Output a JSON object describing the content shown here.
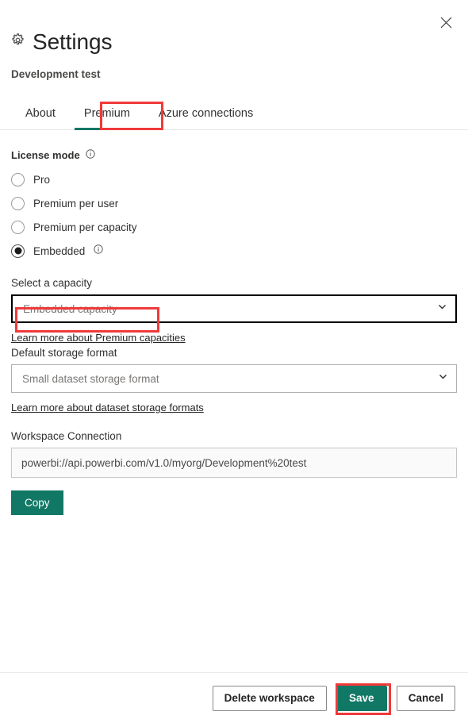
{
  "window": {
    "close_label": "Close",
    "close_icon": "close-icon"
  },
  "header": {
    "gear_icon": "gear-icon",
    "title": "Settings",
    "workspace_name": "Development test"
  },
  "tabs": [
    {
      "label": "About",
      "active": false
    },
    {
      "label": "Premium",
      "active": true
    },
    {
      "label": "Azure connections",
      "active": false
    }
  ],
  "license": {
    "label": "License mode",
    "info_icon": "info-icon",
    "options": [
      {
        "label": "Pro",
        "selected": false,
        "info": false
      },
      {
        "label": "Premium per user",
        "selected": false,
        "info": false
      },
      {
        "label": "Premium per capacity",
        "selected": false,
        "info": false
      },
      {
        "label": "Embedded",
        "selected": true,
        "info": true
      }
    ]
  },
  "capacity": {
    "label": "Select a capacity",
    "value": "Embedded capacity",
    "chevron_icon": "chevron-down-icon",
    "link": "Learn more about Premium capacities"
  },
  "storage": {
    "label": "Default storage format",
    "value": "Small dataset storage format",
    "chevron_icon": "chevron-down-icon",
    "link": "Learn more about dataset storage formats"
  },
  "connection": {
    "label": "Workspace Connection",
    "value": "powerbi://api.powerbi.com/v1.0/myorg/Development%20test",
    "copy_label": "Copy"
  },
  "footer": {
    "delete_label": "Delete workspace",
    "save_label": "Save",
    "cancel_label": "Cancel"
  },
  "colors": {
    "accent_teal": "#117865",
    "annotation_red": "#f03a3a",
    "text": "#323130"
  }
}
